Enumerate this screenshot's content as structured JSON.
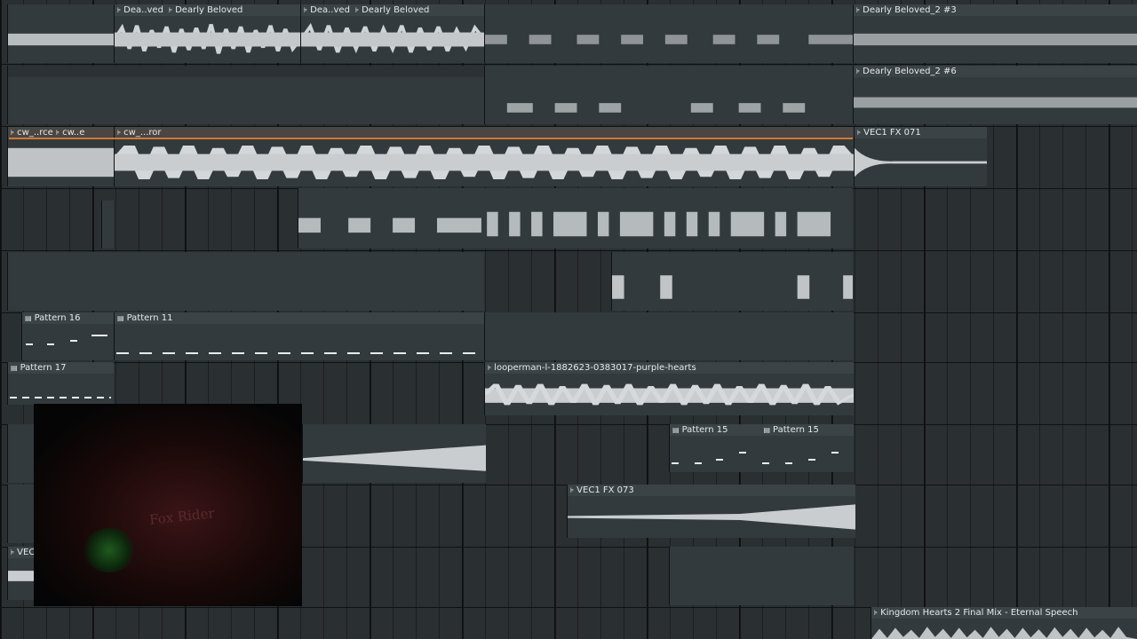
{
  "clips": {
    "dearly_short_1": "Dea..ved",
    "dearly_1": "Dearly Beloved",
    "dearly_short_2": "Dea..ved",
    "dearly_2": "Dearly Beloved",
    "dearly_3": "Dearly Beloved_2 #3",
    "dearly_6": "Dearly Beloved_2 #6",
    "cw_rce": "cw_..rce",
    "cw_e": "cw..e",
    "cw_ror": "cw_...ror",
    "vec1_fx071": "VEC1 FX 071",
    "pattern_16": "Pattern 16",
    "pattern_11": "Pattern 11",
    "pattern_17": "Pattern 17",
    "looperman": "looperman-l-1882623-0383017-purple-hearts",
    "pattern_15": "Pattern 15",
    "vec1_fx073": "VEC1 FX 073",
    "vec_short": "VEC",
    "kingdom": "Kingdom Hearts 2 Final Mix - Eternal Speech"
  },
  "webcam": {
    "shirt_text": "Fox Rider"
  },
  "icons": {
    "audio_clip": "audio-clip-arrow-icon",
    "pattern_clip": "pattern-clip-icon"
  },
  "colors": {
    "background": "#2a2f32",
    "clip": "#333a3e",
    "waveform": "#c9cdcf",
    "playhead_marker": "#d27a30"
  }
}
